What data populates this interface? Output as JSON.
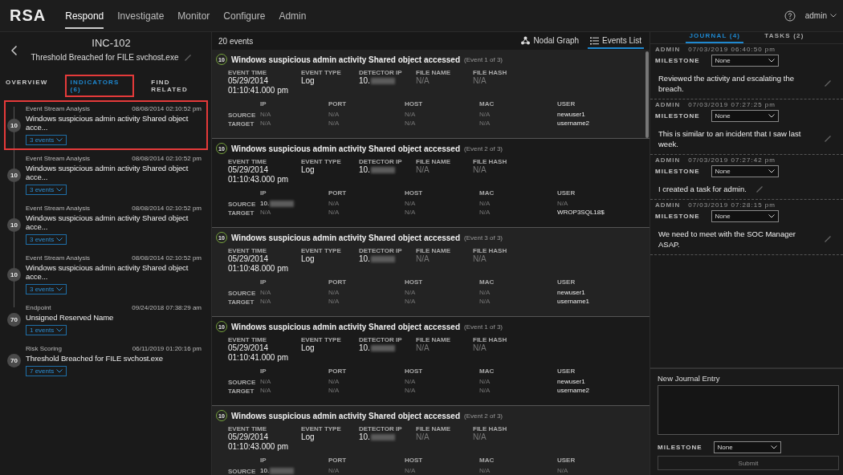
{
  "nav": {
    "logo": "RSA",
    "items": [
      {
        "label": "Respond",
        "selected": true
      },
      {
        "label": "Investigate",
        "selected": false
      },
      {
        "label": "Monitor",
        "selected": false
      },
      {
        "label": "Configure",
        "selected": false
      },
      {
        "label": "Admin",
        "selected": false
      }
    ],
    "user": "admin"
  },
  "incident": {
    "id": "INC-102",
    "title": "Threshold Breached for FILE svchost.exe"
  },
  "left_tabs": [
    {
      "label": "OVERVIEW",
      "selected": false,
      "highlighted": false
    },
    {
      "label": "INDICATORS (6)",
      "selected": true,
      "highlighted": true
    },
    {
      "label": "FIND RELATED",
      "selected": false,
      "highlighted": false
    }
  ],
  "indicators": [
    {
      "source": "Event Stream Analysis",
      "time": "08/08/2014 02:10:52 pm",
      "title": "Windows suspicious admin activity Shared object acce...",
      "score": "10",
      "events": "3 events",
      "highlighted": true
    },
    {
      "source": "Event Stream Analysis",
      "time": "08/08/2014 02:10:52 pm",
      "title": "Windows suspicious admin activity Shared object acce...",
      "score": "10",
      "events": "3 events",
      "highlighted": false
    },
    {
      "source": "Event Stream Analysis",
      "time": "08/08/2014 02:10:52 pm",
      "title": "Windows suspicious admin activity Shared object acce...",
      "score": "10",
      "events": "3 events",
      "highlighted": false
    },
    {
      "source": "Event Stream Analysis",
      "time": "08/08/2014 02:10:52 pm",
      "title": "Windows suspicious admin activity Shared object acce...",
      "score": "10",
      "events": "3 events",
      "highlighted": false
    },
    {
      "source": "Endpoint",
      "time": "09/24/2018 07:38:29 am",
      "title": "Unsigned Reserved Name",
      "score": "70",
      "events": "1 events",
      "highlighted": false
    },
    {
      "source": "Risk Scoring",
      "time": "06/11/2019 01:20:16 pm",
      "title": "Threshold Breached for FILE svchost.exe",
      "score": "70",
      "events": "7 events",
      "highlighted": false
    }
  ],
  "events_header": {
    "count": "20 events",
    "views": [
      {
        "label": "Nodal Graph",
        "kind": "graph",
        "selected": false
      },
      {
        "label": "Events List",
        "kind": "list",
        "selected": true
      }
    ]
  },
  "events": [
    {
      "score": "10",
      "title": "Windows suspicious admin activity Shared object accessed",
      "position": "(Event 1 of 3)",
      "fields": [
        {
          "label": "EVENT TIME",
          "text": "05/29/2014 01:10:41.000 pm",
          "muted": false,
          "masked": false
        },
        {
          "label": "EVENT TYPE",
          "text": "Log",
          "muted": false,
          "masked": false
        },
        {
          "label": "DETECTOR IP",
          "text": "10.",
          "muted": false,
          "masked": true
        },
        {
          "label": "FILE NAME",
          "text": "N/A",
          "muted": true,
          "masked": false
        },
        {
          "label": "FILE HASH",
          "text": "N/A",
          "muted": true,
          "masked": false
        }
      ],
      "columns": [
        "IP",
        "PORT",
        "HOST",
        "MAC",
        "USER"
      ],
      "rows": [
        {
          "label": "SOURCE",
          "cells": [
            {
              "text": "N/A",
              "muted": true,
              "masked": false
            },
            {
              "text": "N/A",
              "muted": true,
              "masked": false
            },
            {
              "text": "N/A",
              "muted": true,
              "masked": false
            },
            {
              "text": "N/A",
              "muted": true,
              "masked": false
            },
            {
              "text": "newuser1",
              "muted": false,
              "masked": false
            }
          ]
        },
        {
          "label": "TARGET",
          "cells": [
            {
              "text": "N/A",
              "muted": true,
              "masked": false
            },
            {
              "text": "N/A",
              "muted": true,
              "masked": false
            },
            {
              "text": "N/A",
              "muted": true,
              "masked": false
            },
            {
              "text": "N/A",
              "muted": true,
              "masked": false
            },
            {
              "text": "username2",
              "muted": false,
              "masked": false
            }
          ]
        }
      ]
    },
    {
      "score": "10",
      "title": "Windows suspicious admin activity Shared object accessed",
      "position": "(Event 2 of 3)",
      "fields": [
        {
          "label": "EVENT TIME",
          "text": "05/29/2014 01:10:43.000 pm",
          "muted": false,
          "masked": false
        },
        {
          "label": "EVENT TYPE",
          "text": "Log",
          "muted": false,
          "masked": false
        },
        {
          "label": "DETECTOR IP",
          "text": "10.",
          "muted": false,
          "masked": true
        },
        {
          "label": "FILE NAME",
          "text": "N/A",
          "muted": true,
          "masked": false
        },
        {
          "label": "FILE HASH",
          "text": "N/A",
          "muted": true,
          "masked": false
        }
      ],
      "columns": [
        "IP",
        "PORT",
        "HOST",
        "MAC",
        "USER"
      ],
      "rows": [
        {
          "label": "SOURCE",
          "cells": [
            {
              "text": "10.",
              "muted": false,
              "masked": true
            },
            {
              "text": "N/A",
              "muted": true,
              "masked": false
            },
            {
              "text": "N/A",
              "muted": true,
              "masked": false
            },
            {
              "text": "N/A",
              "muted": true,
              "masked": false
            },
            {
              "text": "N/A",
              "muted": true,
              "masked": false
            }
          ]
        },
        {
          "label": "TARGET",
          "cells": [
            {
              "text": "N/A",
              "muted": true,
              "masked": false
            },
            {
              "text": "N/A",
              "muted": true,
              "masked": false
            },
            {
              "text": "N/A",
              "muted": true,
              "masked": false
            },
            {
              "text": "N/A",
              "muted": true,
              "masked": false
            },
            {
              "text": "WROP3SQL18$",
              "muted": false,
              "masked": false
            }
          ]
        }
      ]
    },
    {
      "score": "10",
      "title": "Windows suspicious admin activity Shared object accessed",
      "position": "(Event 3 of 3)",
      "fields": [
        {
          "label": "EVENT TIME",
          "text": "05/29/2014 01:10:48.000 pm",
          "muted": false,
          "masked": false
        },
        {
          "label": "EVENT TYPE",
          "text": "Log",
          "muted": false,
          "masked": false
        },
        {
          "label": "DETECTOR IP",
          "text": "10.",
          "muted": false,
          "masked": true
        },
        {
          "label": "FILE NAME",
          "text": "N/A",
          "muted": true,
          "masked": false
        },
        {
          "label": "FILE HASH",
          "text": "N/A",
          "muted": true,
          "masked": false
        }
      ],
      "columns": [
        "IP",
        "PORT",
        "HOST",
        "MAC",
        "USER"
      ],
      "rows": [
        {
          "label": "SOURCE",
          "cells": [
            {
              "text": "N/A",
              "muted": true,
              "masked": false
            },
            {
              "text": "N/A",
              "muted": true,
              "masked": false
            },
            {
              "text": "N/A",
              "muted": true,
              "masked": false
            },
            {
              "text": "N/A",
              "muted": true,
              "masked": false
            },
            {
              "text": "newuser1",
              "muted": false,
              "masked": false
            }
          ]
        },
        {
          "label": "TARGET",
          "cells": [
            {
              "text": "N/A",
              "muted": true,
              "masked": false
            },
            {
              "text": "N/A",
              "muted": true,
              "masked": false
            },
            {
              "text": "N/A",
              "muted": true,
              "masked": false
            },
            {
              "text": "N/A",
              "muted": true,
              "masked": false
            },
            {
              "text": "username1",
              "muted": false,
              "masked": false
            }
          ]
        }
      ]
    },
    {
      "score": "10",
      "title": "Windows suspicious admin activity Shared object accessed",
      "position": "(Event 1 of 3)",
      "fields": [
        {
          "label": "EVENT TIME",
          "text": "05/29/2014 01:10:41.000 pm",
          "muted": false,
          "masked": false
        },
        {
          "label": "EVENT TYPE",
          "text": "Log",
          "muted": false,
          "masked": false
        },
        {
          "label": "DETECTOR IP",
          "text": "10.",
          "muted": false,
          "masked": true
        },
        {
          "label": "FILE NAME",
          "text": "N/A",
          "muted": true,
          "masked": false
        },
        {
          "label": "FILE HASH",
          "text": "N/A",
          "muted": true,
          "masked": false
        }
      ],
      "columns": [
        "IP",
        "PORT",
        "HOST",
        "MAC",
        "USER"
      ],
      "rows": [
        {
          "label": "SOURCE",
          "cells": [
            {
              "text": "N/A",
              "muted": true,
              "masked": false
            },
            {
              "text": "N/A",
              "muted": true,
              "masked": false
            },
            {
              "text": "N/A",
              "muted": true,
              "masked": false
            },
            {
              "text": "N/A",
              "muted": true,
              "masked": false
            },
            {
              "text": "newuser1",
              "muted": false,
              "masked": false
            }
          ]
        },
        {
          "label": "TARGET",
          "cells": [
            {
              "text": "N/A",
              "muted": true,
              "masked": false
            },
            {
              "text": "N/A",
              "muted": true,
              "masked": false
            },
            {
              "text": "N/A",
              "muted": true,
              "masked": false
            },
            {
              "text": "N/A",
              "muted": true,
              "masked": false
            },
            {
              "text": "username2",
              "muted": false,
              "masked": false
            }
          ]
        }
      ]
    },
    {
      "score": "10",
      "title": "Windows suspicious admin activity Shared object accessed",
      "position": "(Event 2 of 3)",
      "fields": [
        {
          "label": "EVENT TIME",
          "text": "05/29/2014 01:10:43.000 pm",
          "muted": false,
          "masked": false
        },
        {
          "label": "EVENT TYPE",
          "text": "Log",
          "muted": false,
          "masked": false
        },
        {
          "label": "DETECTOR IP",
          "text": "10.",
          "muted": false,
          "masked": true
        },
        {
          "label": "FILE NAME",
          "text": "N/A",
          "muted": true,
          "masked": false
        },
        {
          "label": "FILE HASH",
          "text": "N/A",
          "muted": true,
          "masked": false
        }
      ],
      "columns": [
        "IP",
        "PORT",
        "HOST",
        "MAC",
        "USER"
      ],
      "rows": [
        {
          "label": "SOURCE",
          "cells": [
            {
              "text": "10.",
              "muted": false,
              "masked": true
            },
            {
              "text": "N/A",
              "muted": true,
              "masked": false
            },
            {
              "text": "N/A",
              "muted": true,
              "masked": false
            },
            {
              "text": "N/A",
              "muted": true,
              "masked": false
            },
            {
              "text": "N/A",
              "muted": true,
              "masked": false
            }
          ]
        }
      ]
    }
  ],
  "journal": {
    "tabs": [
      {
        "label": "JOURNAL (4)",
        "selected": true
      },
      {
        "label": "TASKS (2)",
        "selected": false
      }
    ],
    "entries": [
      {
        "author": "ADMIN",
        "time": "07/03/2019 06:40:50 pm",
        "milestone_label": "MILESTONE",
        "milestone": "None",
        "text": "Reviewed the activity and escalating the breach."
      },
      {
        "author": "ADMIN",
        "time": "07/03/2019 07:27:25 pm",
        "milestone_label": "MILESTONE",
        "milestone": "None",
        "text": "This is similar to an incident that I saw last week."
      },
      {
        "author": "ADMIN",
        "time": "07/03/2019 07:27:42 pm",
        "milestone_label": "MILESTONE",
        "milestone": "None",
        "text": "I created a task for admin."
      },
      {
        "author": "ADMIN",
        "time": "07/03/2019 07:28:15 pm",
        "milestone_label": "MILESTONE",
        "milestone": "None",
        "text": "We need to meet with the SOC Manager ASAP."
      }
    ],
    "new_entry": {
      "label": "New Journal Entry",
      "milestone_label": "MILESTONE",
      "milestone": "None",
      "submit": "Submit",
      "submit_disabled": true
    }
  }
}
